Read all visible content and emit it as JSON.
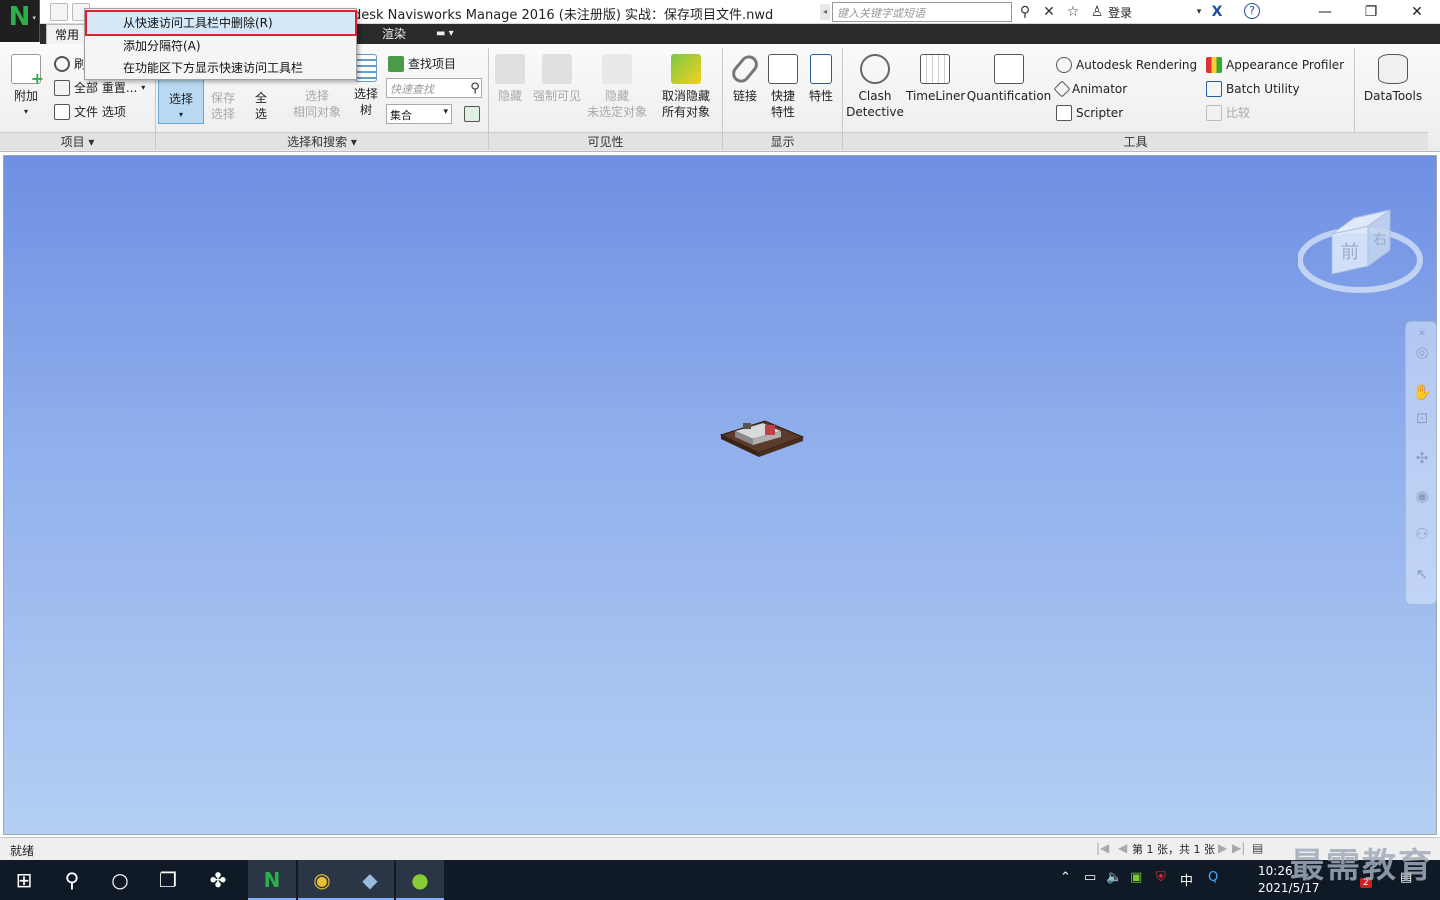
{
  "title_bar": {
    "title": "odesk Navisworks Manage 2016 (未注册版)    实战：保存项目文件.nwd",
    "search_placeholder": "键入关键字或短语",
    "sign_in": "登录",
    "help": "?"
  },
  "context_menu": {
    "items": [
      {
        "label": "从快速访问工具栏中删除(R)"
      },
      {
        "label": "添加分隔符(A)"
      },
      {
        "label": "在功能区下方显示快速访问工具栏"
      }
    ]
  },
  "tabs": [
    {
      "label": "常用"
    },
    {
      "label": "渲染"
    }
  ],
  "ribbon": {
    "project_panel": {
      "label": "项目",
      "append": "附加",
      "refresh": "刷",
      "reset_all": "全部 重置...",
      "file_options": "文件 选项"
    },
    "select_panel": {
      "label": "选择和搜索",
      "select": "选择",
      "save_selection": [
        "保存",
        "选择"
      ],
      "select_all": [
        "全",
        "选"
      ],
      "select_same": [
        "选择",
        "相同对象"
      ],
      "selection_tree": [
        "选择",
        "树"
      ],
      "find_items": "查找项目",
      "quick_find_placeholder": "快速查找",
      "sets": "集合"
    },
    "visibility_panel": {
      "label": "可见性",
      "hide": "隐藏",
      "require": "强制可见",
      "hide_unselected": [
        "隐藏",
        "未选定对象"
      ],
      "unhide_all": [
        "取消隐藏",
        "所有对象"
      ]
    },
    "display_panel": {
      "label": "显示",
      "links": "链接",
      "quick_props": [
        "快捷",
        "特性"
      ],
      "properties": "特性"
    },
    "tools_panel": {
      "label": "工具",
      "clash": [
        "Clash",
        "Detective"
      ],
      "timeliner": "TimeLiner",
      "quantification": "Quantification",
      "rendering": "Autodesk Rendering",
      "animator": "Animator",
      "scripter": "Scripter",
      "appearance": "Appearance Profiler",
      "batch": "Batch Utility",
      "compare": "比较",
      "datatools": "DataTools"
    }
  },
  "viewcube": {
    "face": "前",
    "side": "右"
  },
  "status_bar": {
    "status": "就绪",
    "sheet": "第 1 张，共 1 张"
  },
  "taskbar": {
    "ime": "中",
    "time": "10:26",
    "date": "2021/5/17",
    "notif_count": "2"
  },
  "watermark": "最需教育"
}
